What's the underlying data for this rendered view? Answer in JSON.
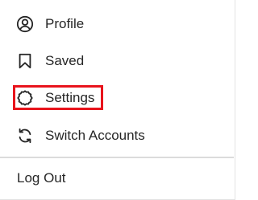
{
  "menu": {
    "items": [
      {
        "label": "Profile",
        "icon": "profile-circle-icon"
      },
      {
        "label": "Saved",
        "icon": "bookmark-icon"
      },
      {
        "label": "Settings",
        "icon": "gear-icon"
      },
      {
        "label": "Switch Accounts",
        "icon": "switch-arrows-icon"
      }
    ],
    "logout_label": "Log Out"
  },
  "colors": {
    "text": "#262626",
    "divider": "#dbdbdb",
    "highlight": "#e8141c"
  }
}
